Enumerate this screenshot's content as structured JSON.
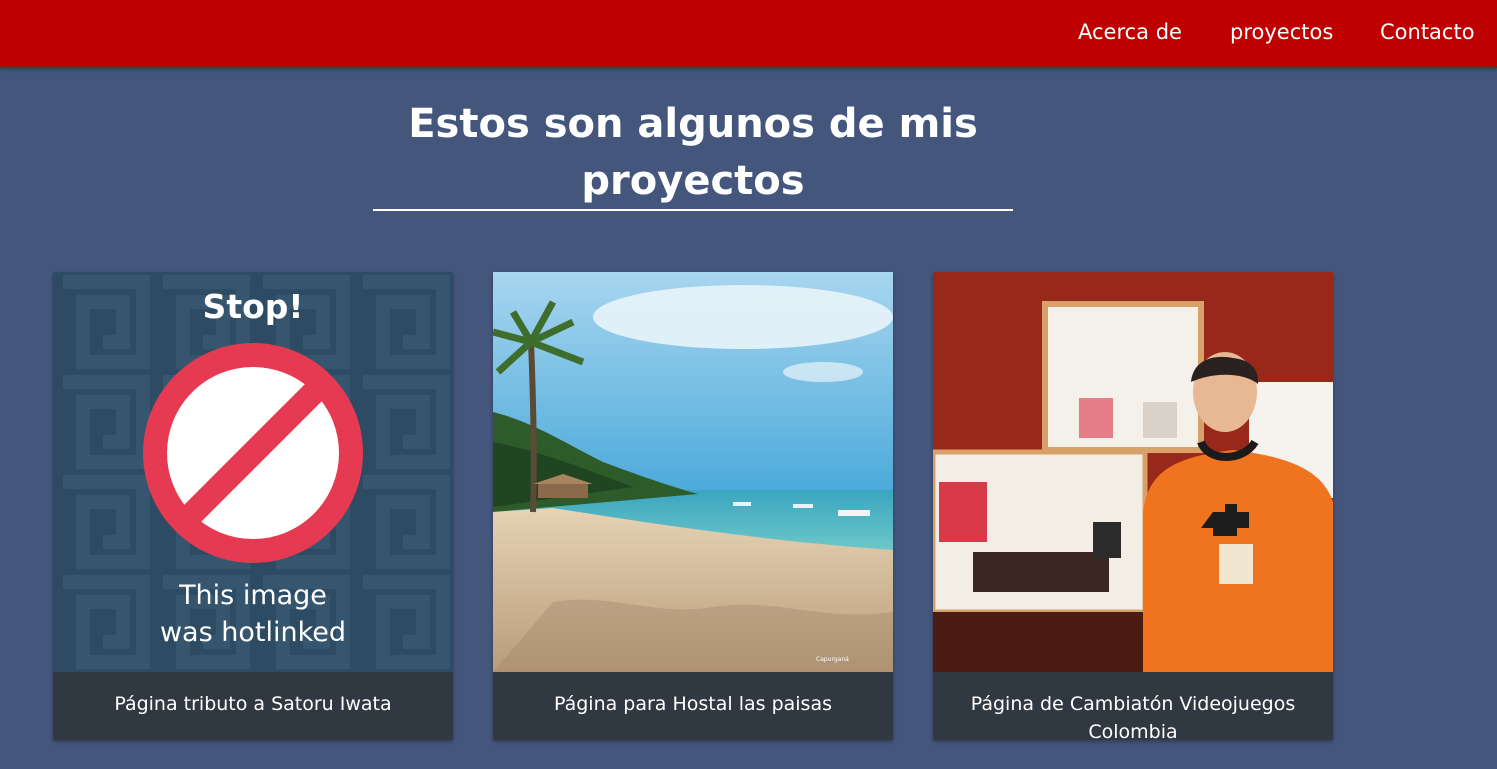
{
  "nav": {
    "about": "Acerca de",
    "projects": "proyectos",
    "contact": "Contacto"
  },
  "section": {
    "title": "Estos son algunos de mis proyectos"
  },
  "projects": [
    {
      "caption": "Página tributo a Satoru Iwata",
      "image": {
        "heading": "Stop!",
        "line1": "This image",
        "line2": "was hotlinked",
        "icon": "prohibited-icon"
      }
    },
    {
      "caption": "Página para Hostal las paisas",
      "image": {
        "watermark": "Capurganá"
      }
    },
    {
      "caption": "Página de Cambiatón Videojuegos Colombia"
    }
  ],
  "colors": {
    "navbar": "#be0000",
    "background": "#45567d",
    "card": "#303841",
    "prohibited_red": "#e63a53"
  }
}
